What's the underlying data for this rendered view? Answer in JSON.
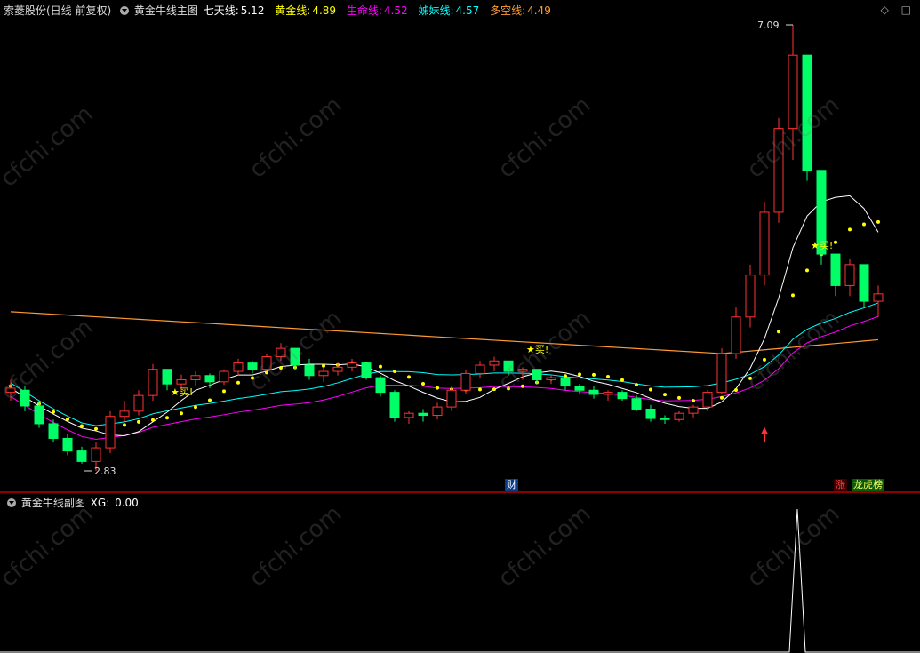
{
  "main_header": {
    "stock": "索菱股份(日线 前复权)",
    "indicator": "黄金牛线主图",
    "items": [
      {
        "label": "七天线:",
        "value": "5.12",
        "color": "#ffffff"
      },
      {
        "label": "黄金线:",
        "value": "4.89",
        "color": "#ffff00"
      },
      {
        "label": "生命线:",
        "value": "4.52",
        "color": "#ff00ff"
      },
      {
        "label": "姊妹线:",
        "value": "4.57",
        "color": "#00ffff"
      },
      {
        "label": "多空线:",
        "value": "4.49",
        "color": "#ff9933"
      }
    ]
  },
  "sub_header": {
    "indicator": "黄金牛线副图",
    "xg_label": "XG:",
    "xg_value": "0.00"
  },
  "annotations": {
    "high": "7.09",
    "low": "2.83",
    "buy1": "★买!",
    "buy2": "★买!",
    "buy3": "★买!"
  },
  "badges": {
    "cai": "财",
    "zhang": "涨",
    "longhu": "龙虎榜"
  },
  "icons": {
    "circle": "menu-circle-icon",
    "diamond": "diamond-icon",
    "square": "square-icon"
  },
  "watermark": "cfchi.com",
  "colors": {
    "up": "#ff3333",
    "down": "#00ff66",
    "ma7": "#ffffff",
    "gold": "#ffff00",
    "life": "#ff00ff",
    "sister": "#00ffff",
    "dk": "#ff9933"
  },
  "chart_data": {
    "type": "candlestick",
    "price_range": [
      2.83,
      7.09
    ],
    "candle_count": 62,
    "candles": [
      [
        3.58,
        3.7,
        3.5,
        3.62
      ],
      [
        3.6,
        3.64,
        3.4,
        3.45
      ],
      [
        3.45,
        3.5,
        3.24,
        3.28
      ],
      [
        3.28,
        3.32,
        3.1,
        3.14
      ],
      [
        3.14,
        3.18,
        2.98,
        3.02
      ],
      [
        3.02,
        3.06,
        2.9,
        2.92
      ],
      [
        2.92,
        3.1,
        2.83,
        3.05
      ],
      [
        3.05,
        3.4,
        3.0,
        3.35
      ],
      [
        3.35,
        3.5,
        3.3,
        3.4
      ],
      [
        3.4,
        3.6,
        3.36,
        3.55
      ],
      [
        3.55,
        3.85,
        3.5,
        3.8
      ],
      [
        3.8,
        3.72,
        3.6,
        3.66
      ],
      [
        3.66,
        3.75,
        3.6,
        3.7
      ],
      [
        3.7,
        3.78,
        3.64,
        3.74
      ],
      [
        3.74,
        3.76,
        3.62,
        3.68
      ],
      [
        3.68,
        3.8,
        3.65,
        3.78
      ],
      [
        3.78,
        3.9,
        3.74,
        3.86
      ],
      [
        3.86,
        3.88,
        3.76,
        3.8
      ],
      [
        3.8,
        3.95,
        3.78,
        3.92
      ],
      [
        3.92,
        4.05,
        3.88,
        4.0
      ],
      [
        4.0,
        3.92,
        3.8,
        3.84
      ],
      [
        3.84,
        3.9,
        3.7,
        3.74
      ],
      [
        3.74,
        3.82,
        3.68,
        3.78
      ],
      [
        3.78,
        3.86,
        3.74,
        3.82
      ],
      [
        3.82,
        3.9,
        3.78,
        3.86
      ],
      [
        3.86,
        3.8,
        3.7,
        3.72
      ],
      [
        3.72,
        3.74,
        3.54,
        3.58
      ],
      [
        3.58,
        3.6,
        3.3,
        3.34
      ],
      [
        3.34,
        3.4,
        3.28,
        3.38
      ],
      [
        3.38,
        3.42,
        3.3,
        3.36
      ],
      [
        3.36,
        3.48,
        3.32,
        3.44
      ],
      [
        3.44,
        3.64,
        3.4,
        3.6
      ],
      [
        3.6,
        3.8,
        3.56,
        3.76
      ],
      [
        3.76,
        3.88,
        3.72,
        3.84
      ],
      [
        3.84,
        3.92,
        3.78,
        3.88
      ],
      [
        3.88,
        3.84,
        3.74,
        3.78
      ],
      [
        3.78,
        3.82,
        3.7,
        3.8
      ],
      [
        3.8,
        3.76,
        3.66,
        3.7
      ],
      [
        3.7,
        3.74,
        3.66,
        3.72
      ],
      [
        3.72,
        3.68,
        3.6,
        3.64
      ],
      [
        3.64,
        3.66,
        3.56,
        3.6
      ],
      [
        3.6,
        3.64,
        3.52,
        3.56
      ],
      [
        3.56,
        3.6,
        3.5,
        3.58
      ],
      [
        3.58,
        3.6,
        3.5,
        3.52
      ],
      [
        3.52,
        3.55,
        3.4,
        3.42
      ],
      [
        3.42,
        3.46,
        3.3,
        3.33
      ],
      [
        3.33,
        3.36,
        3.28,
        3.32
      ],
      [
        3.32,
        3.4,
        3.3,
        3.38
      ],
      [
        3.38,
        3.46,
        3.34,
        3.44
      ],
      [
        3.44,
        3.6,
        3.4,
        3.58
      ],
      [
        3.58,
        4.0,
        3.56,
        3.95
      ],
      [
        3.95,
        4.4,
        3.9,
        4.3
      ],
      [
        4.3,
        4.8,
        4.2,
        4.7
      ],
      [
        4.7,
        5.4,
        4.6,
        5.3
      ],
      [
        5.3,
        6.2,
        5.2,
        6.1
      ],
      [
        6.1,
        7.09,
        5.8,
        6.8
      ],
      [
        6.8,
        6.4,
        5.6,
        5.7
      ],
      [
        5.7,
        5.2,
        4.8,
        4.9
      ],
      [
        4.9,
        4.7,
        4.5,
        4.6
      ],
      [
        4.6,
        4.85,
        4.5,
        4.8
      ],
      [
        4.8,
        4.7,
        4.4,
        4.45
      ],
      [
        4.45,
        4.6,
        4.3,
        4.52
      ]
    ]
  }
}
